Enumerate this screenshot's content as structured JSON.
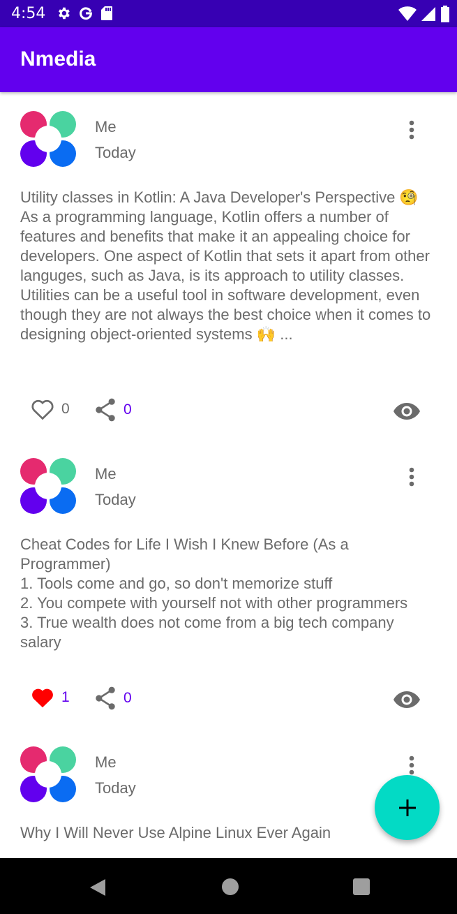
{
  "status_bar": {
    "time": "4:54",
    "icons_left": [
      "settings-icon",
      "google-icon",
      "sd-card-icon"
    ],
    "icons_right": [
      "wifi-icon",
      "cell-signal-icon",
      "battery-icon"
    ]
  },
  "app_bar": {
    "title": "Nmedia"
  },
  "colors": {
    "primary": "#6200ee",
    "primary_dark": "#3700b3",
    "secondary": "#03dac5",
    "liked": "#ff0000",
    "text_secondary": "#6b6b6b"
  },
  "posts": [
    {
      "author": "Me",
      "published": "Today",
      "content": "Utility classes in Kotlin: A Java Developer's Perspective 🧐\nAs a programming language, Kotlin offers a number of features and benefits that make it an appealing choice for developers. One aspect of Kotlin that sets it apart from other languges, such as Java, is its approach to utility classes. Utilities can be a useful tool in software development, even though they are not always the best choice when it comes to designing object-oriented systems 🙌 ...",
      "likes": "0",
      "liked": false,
      "shares": "0"
    },
    {
      "author": "Me",
      "published": "Today",
      "content": "Cheat Codes for Life I Wish I Knew Before (As a Programmer)\n1. Tools come and go, so don't memorize stuff\n2. You compete with yourself not with other programmers\n3. True wealth does not come from a big tech company salary",
      "likes": "1",
      "liked": true,
      "shares": "0"
    },
    {
      "author": "Me",
      "published": "Today",
      "content": "Why I Will Never Use Alpine Linux Ever Again"
    }
  ],
  "fab": {
    "icon": "plus-icon"
  },
  "nav_bar": {
    "icons": [
      "back-icon",
      "home-icon",
      "recents-icon"
    ]
  }
}
